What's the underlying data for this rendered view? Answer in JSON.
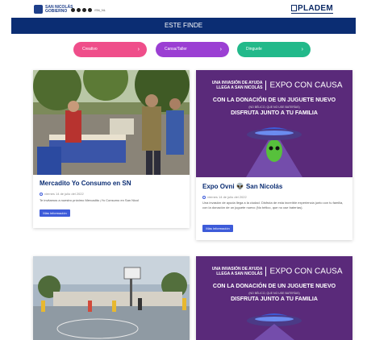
{
  "header": {
    "logo_text_line1": "SAN NICOLÁS",
    "logo_text_line2": "GOBIERNO",
    "social_handle": "/SN_NL",
    "brand": "PLADEM"
  },
  "section_title": "ESTE FINDE",
  "filters": [
    {
      "label": "Creativo",
      "arrow": "›",
      "color": "#ef4e8a"
    },
    {
      "label": "Cansa/Taller",
      "arrow": "›",
      "color": "#9b3fd3"
    },
    {
      "label": "Dinguele",
      "arrow": "›",
      "color": "#22b98a"
    }
  ],
  "cards": [
    {
      "title": "Mercadito Yo Consumo en SN",
      "date": "viernes 14 de julio del 2022",
      "description": "Te invitamos a nuestro próximo Mercadito ¡Yo Consumo en San Nicol",
      "button": "Más información"
    },
    {
      "title": "Expo Ovni 👽 San Nicolás",
      "date": "viernes 14 de julio del 2022",
      "description": "Una invasión de ayuda llega a la ciudad. Disfruta de esta increíble experiencia junto con tu familia, con la donación de un juguete nuevo (No bélico, que no use baterías).",
      "button": "Más información",
      "poster": {
        "headline_left": "UNA INVASIÓN DE AYUDA LLEGA A SAN NICOLÁS",
        "headline_right": "EXPO CON CAUSA",
        "line1": "CON LA DONACIÓN DE UN JUGUETE NUEVO",
        "line_small": "(NO BÉLICO, QUE NO USE BATERÍAS)",
        "line2": "DISFRUTA JUNTO A TU FAMILIA"
      }
    },
    {
      "poster": {
        "headline_left": "UNA INVASIÓN DE AYUDA LLEGA A SAN NICOLÁS",
        "headline_right": "EXPO CON CAUSA",
        "line1": "CON LA DONACIÓN DE UN JUGUETE NUEVO",
        "line_small": "(NO BÉLICO, QUE NO USE BATERÍAS)",
        "line2": "DISFRUTA JUNTO A TU FAMILIA"
      }
    }
  ],
  "colors": {
    "navy": "#0b2d73",
    "button_blue": "#3d5bd9",
    "poster_purple": "#5a2a7a"
  }
}
